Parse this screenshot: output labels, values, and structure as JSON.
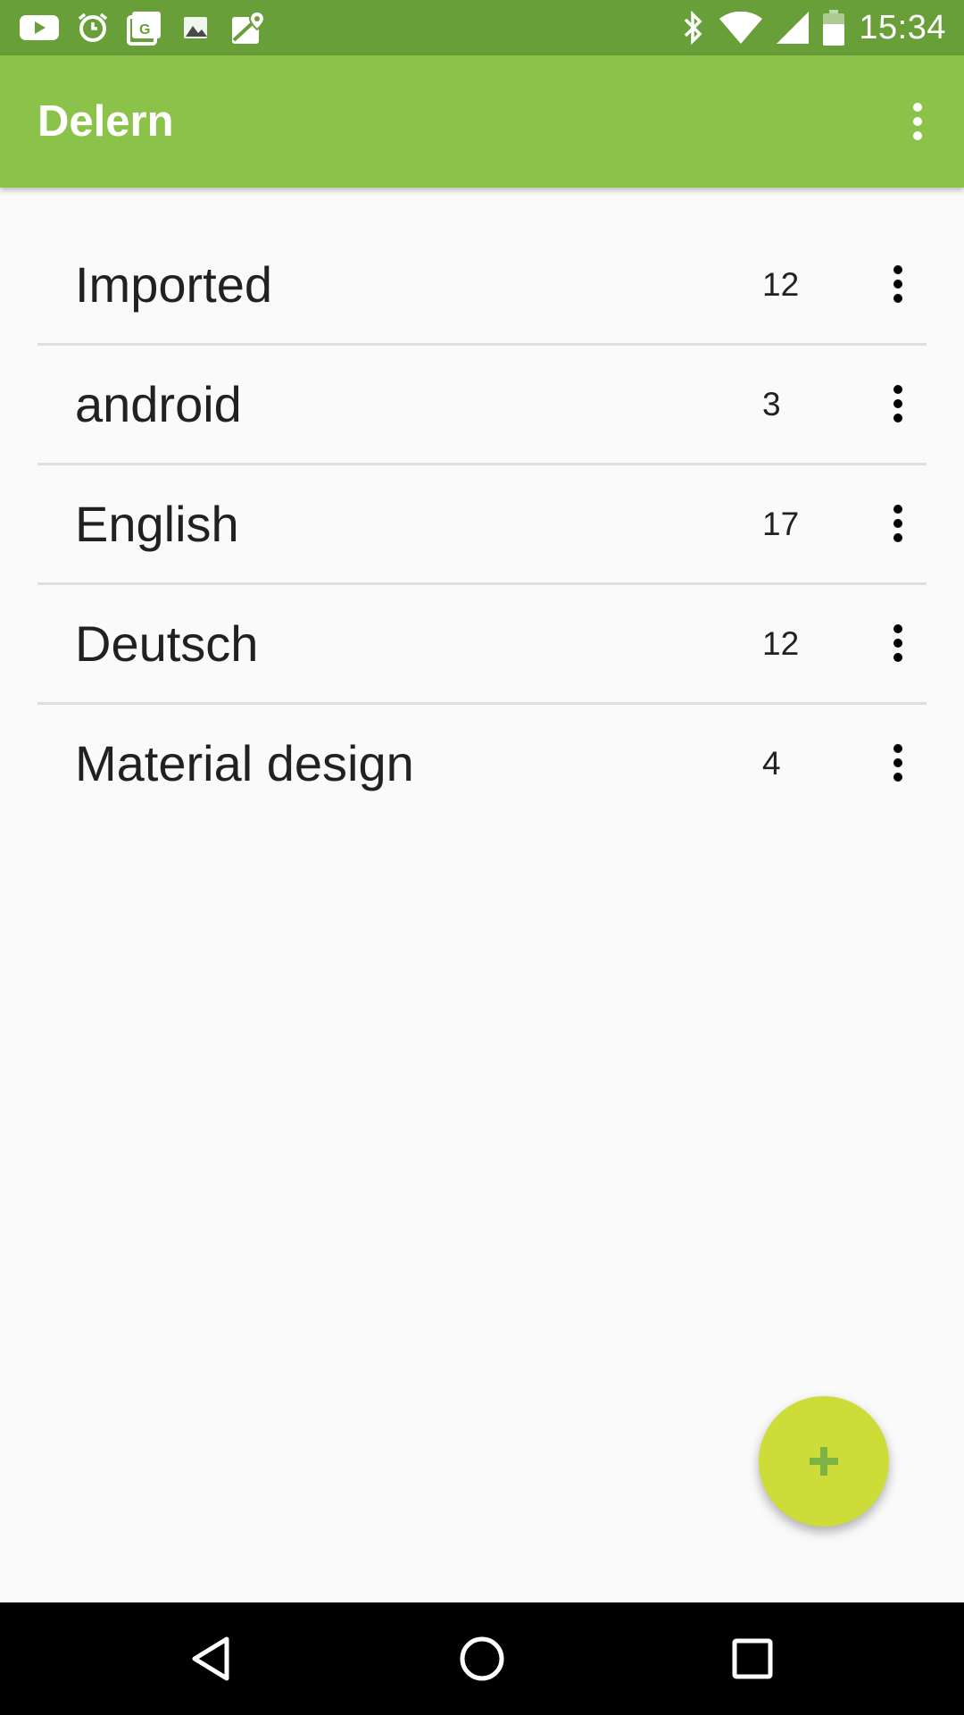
{
  "status_bar": {
    "time": "15:34",
    "left_icons": [
      "youtube-icon",
      "alarm-icon",
      "google-plus-icon",
      "image-icon",
      "maps-icon"
    ],
    "right_icons": [
      "bluetooth-icon",
      "wifi-icon",
      "signal-icon",
      "battery-icon"
    ]
  },
  "app_bar": {
    "title": "Delern",
    "menu_icon": "more-vert-icon"
  },
  "decks": [
    {
      "name": "Imported",
      "count": "12"
    },
    {
      "name": "android",
      "count": "3"
    },
    {
      "name": "English",
      "count": "17"
    },
    {
      "name": "Deutsch",
      "count": "12"
    },
    {
      "name": "Material design",
      "count": "4"
    }
  ],
  "fab": {
    "icon": "add-icon",
    "color": "#cddc39",
    "icon_color": "#7cb342"
  },
  "colors": {
    "status_bar": "#689f38",
    "app_bar": "#8bc34a",
    "background": "#fafafa",
    "nav_bar": "#000000"
  },
  "nav_bar": {
    "buttons": [
      "back-icon",
      "home-icon",
      "recents-icon"
    ]
  }
}
